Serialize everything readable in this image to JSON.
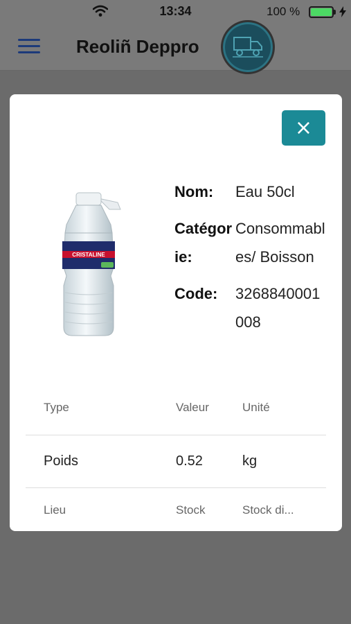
{
  "status_bar": {
    "time": "13:34",
    "battery_percent": "100 %",
    "battery_level": 1.0
  },
  "header": {
    "title": "Reoliñ Deppro",
    "menu_icon": "hamburger-menu-icon",
    "logo_icon": "delivery-truck-icon"
  },
  "modal": {
    "close_label": "×",
    "product_image_icon": "water-bottle-image",
    "fields": [
      {
        "label": "Nom:",
        "value": "Eau 50cl"
      },
      {
        "label": "Catégorie:",
        "value": "Consommables/ Boisson"
      },
      {
        "label": "Code:",
        "value": "3268840001008"
      }
    ],
    "table": {
      "headers": [
        "Type",
        "Valeur",
        "Unité"
      ],
      "rows": [
        [
          "Poids",
          "0.52",
          "kg"
        ]
      ],
      "second_headers": [
        "Lieu",
        "Stock",
        "Stock di..."
      ]
    }
  },
  "colors": {
    "accent": "#1b8a96",
    "overlay": "#6b6b6b",
    "menu_icon": "#1c3a7a",
    "battery": "#4cd964"
  }
}
